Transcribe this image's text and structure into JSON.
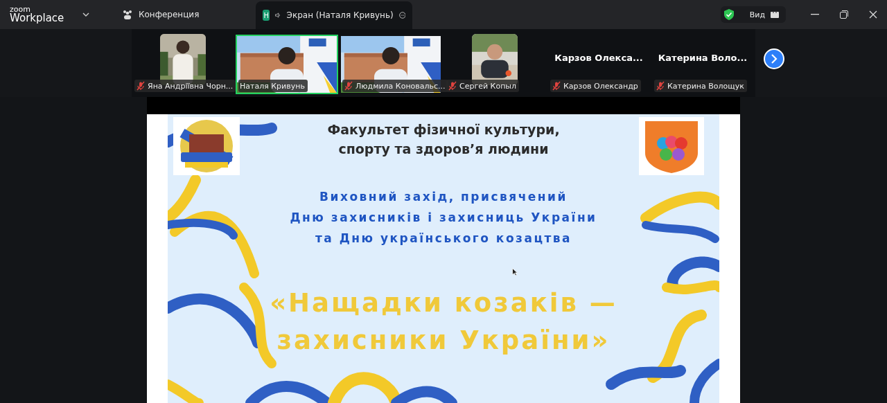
{
  "app": {
    "brand_top": "zoom",
    "brand_bottom": "Workplace"
  },
  "tabs": [
    {
      "label": "Конференция",
      "kind": "meeting",
      "selected": false
    },
    {
      "label": "Экран (Наталя Кривунь)",
      "kind": "share",
      "badge": "H",
      "selected": true
    }
  ],
  "view_button": {
    "label": "Вид"
  },
  "participants": [
    {
      "kind": "thumbnail",
      "label": "Яна Андріївна Чорн...",
      "muted": true,
      "selected": false
    },
    {
      "kind": "video",
      "label": "Наталя Кривунь",
      "muted": false,
      "selected": true
    },
    {
      "kind": "video",
      "label": "Людмила Коновальс...",
      "muted": true,
      "selected": false
    },
    {
      "kind": "thumbnail",
      "label": "Сергей Копыл",
      "muted": true,
      "selected": false
    },
    {
      "kind": "name",
      "title": "Карзов  Олекса...",
      "label": "Карзов Олександр",
      "muted": true,
      "selected": false
    },
    {
      "kind": "name",
      "title": "Катерина  Воло...",
      "label": "Катерина Волощук",
      "muted": true,
      "selected": false
    }
  ],
  "slide": {
    "heading": [
      "Факультет фізичної культури,",
      "спорту та здоров’я людини"
    ],
    "subheading": [
      "Виховний захід, присвячений",
      "Дню захисників і захисниць України",
      "та Дню українського козацтва"
    ],
    "title": [
      "«Нащадки козаків —",
      "захисники України»"
    ]
  }
}
